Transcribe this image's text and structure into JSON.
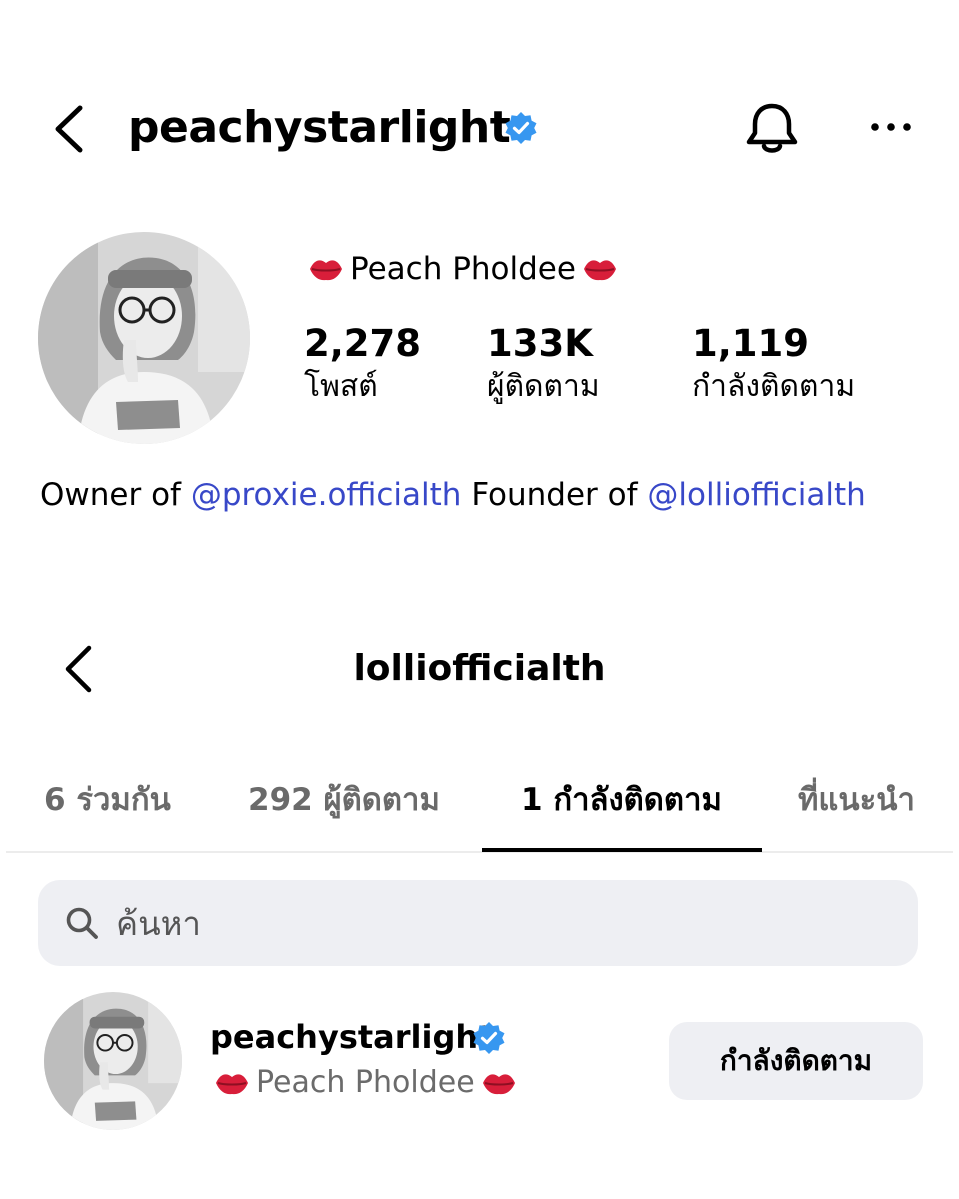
{
  "colors": {
    "verified_badge": "#3797f0",
    "mention_link": "#3848c8",
    "tab_inactive": "#6a6a6a",
    "surface_gray": "#eeeff3"
  },
  "icons": {
    "back": "chevron-left-icon",
    "verified": "verified-badge-icon",
    "notifications": "bell-icon",
    "more": "more-horizontal-icon",
    "lips": "kiss-mark-emoji-icon",
    "search": "search-icon"
  },
  "profile": {
    "username": "peachystarlight",
    "display_name": "Peach Pholdee",
    "stats": {
      "posts": {
        "value": "2,278",
        "label": "โพสต์"
      },
      "followers": {
        "value": "133K",
        "label": "ผู้ติดตาม"
      },
      "following": {
        "value": "1,119",
        "label": "กำลังติดตาม"
      }
    },
    "bio": {
      "owner_prefix": "Owner of ",
      "owner_mention": "@proxie.officialth",
      "founder_prefix": " Founder of ",
      "founder_mention": "@lolliofficialth"
    }
  },
  "follow_list": {
    "title": "lolliofficialth",
    "tabs": [
      {
        "label": "6 ร่วมกัน",
        "active": false
      },
      {
        "label": "292 ผู้ติดตาม",
        "active": false
      },
      {
        "label": "1 กำลังติดตาม",
        "active": true
      },
      {
        "label": "ที่แนะนำ",
        "active": false
      }
    ],
    "search": {
      "placeholder": "ค้นหา",
      "value": ""
    },
    "accounts": [
      {
        "username": "peachystarlight",
        "full_name": "Peach Pholdee",
        "verified": true,
        "button_label": "กำลังติดตาม"
      }
    ]
  }
}
